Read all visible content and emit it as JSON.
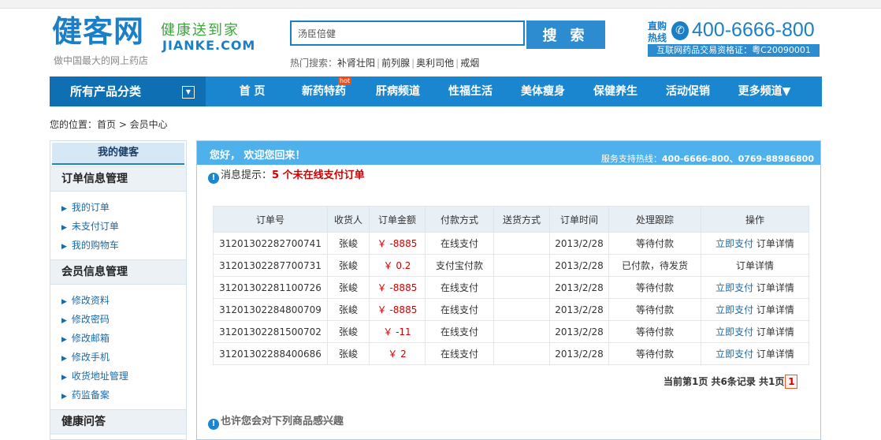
{
  "header": {
    "logo_cn": "健客网",
    "logo_slogan": "健康送到家",
    "logo_en": "JIANKE.COM",
    "logo_tagline": "做中国最大的网上药店",
    "search_value": "汤臣倍健",
    "search_button": "搜 索",
    "hot_search_label": "热门搜索：",
    "hot_search_items": [
      "补肾壮阳",
      "前列腺",
      "奥利司他",
      "戒烟"
    ],
    "hotline_label": "直购热线",
    "phone": "400-6666-800",
    "license": "互联网药品交易资格证：粤C20090001"
  },
  "nav": {
    "all_categories": "所有产品分类",
    "hot_badge": "hot",
    "items": [
      "首 页",
      "新药特药",
      "肝病频道",
      "性福生活",
      "美体瘦身",
      "保健养生",
      "活动促销",
      "更多频道▼"
    ]
  },
  "breadcrumb": "您的位置：首页 > 会员中心",
  "sidebar": {
    "title": "我的健客",
    "sections": [
      {
        "title": "订单信息管理",
        "items": [
          "我的订单",
          "未支付订单",
          "我的购物车"
        ]
      },
      {
        "title": "会员信息管理",
        "items": [
          "修改资料",
          "修改密码",
          "修改邮箱",
          "修改手机",
          "收货地址管理",
          "药监备案"
        ]
      },
      {
        "title": "健康问答",
        "items": []
      }
    ]
  },
  "main": {
    "welcome": "您好， 欢迎您回来！",
    "service_label": "服务支持热线：",
    "service_phones": "400-6666-800、0769-88986800",
    "notice_label": "消息提示：",
    "notice_count": "5 个未在线支付订单",
    "table_headers": [
      "订单号",
      "收货人",
      "订单金额",
      "付款方式",
      "送货方式",
      "订单时间",
      "处理跟踪",
      "操作"
    ],
    "orders": [
      {
        "id": "31201302282700741",
        "receiver": "张峻",
        "amount": "￥ -8885",
        "payment": "在线支付",
        "delivery": "",
        "date": "2013/2/28",
        "status": "等待付款",
        "pay_link": "立即支付",
        "detail": "订单详情"
      },
      {
        "id": "31201302287700731",
        "receiver": "张峻",
        "amount": "￥ 0.2",
        "payment": "支付宝付款",
        "delivery": "",
        "date": "2013/2/28",
        "status": "已付款，待发货",
        "pay_link": "",
        "detail": "订单详情"
      },
      {
        "id": "31201302281100726",
        "receiver": "张峻",
        "amount": "￥ -8885",
        "payment": "在线支付",
        "delivery": "",
        "date": "2013/2/28",
        "status": "等待付款",
        "pay_link": "立即支付",
        "detail": "订单详情"
      },
      {
        "id": "31201302284800709",
        "receiver": "张峻",
        "amount": "￥ -8885",
        "payment": "在线支付",
        "delivery": "",
        "date": "2013/2/28",
        "status": "等待付款",
        "pay_link": "立即支付",
        "detail": "订单详情"
      },
      {
        "id": "31201302281500702",
        "receiver": "张峻",
        "amount": "￥ -11",
        "payment": "在线支付",
        "delivery": "",
        "date": "2013/2/28",
        "status": "等待付款",
        "pay_link": "立即支付",
        "detail": "订单详情"
      },
      {
        "id": "31201302288400686",
        "receiver": "张峻",
        "amount": "￥ 2",
        "payment": "在线支付",
        "delivery": "",
        "date": "2013/2/28",
        "status": "等待付款",
        "pay_link": "立即支付",
        "detail": "订单详情"
      }
    ],
    "pager_text": "当前第1页 共6条记录 共1页",
    "current_page": "1",
    "interest_title": "也许您会对下列商品感兴趣"
  },
  "colors": {
    "brand_blue": "#1a86cf",
    "accent_red": "#d10000",
    "header_blue": "#4eb1ec"
  },
  "icons": [
    "info-icon",
    "phone-icon",
    "dropdown-arrow-icon",
    "bullet-arrow-icon"
  ]
}
